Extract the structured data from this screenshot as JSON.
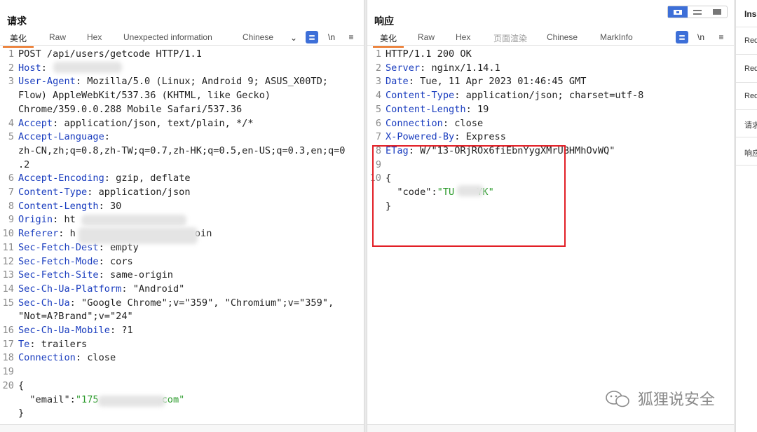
{
  "request": {
    "title": "请求",
    "tabs": [
      "美化",
      "Raw",
      "Hex",
      "Unexpected information",
      "Chinese"
    ],
    "active_tab": "美化",
    "tools": {
      "wrap": "\\n",
      "menu": "≡"
    },
    "lines": [
      {
        "n": "1",
        "key": "",
        "val": "POST /api/users/getcode HTTP/1.1"
      },
      {
        "n": "2",
        "key": "Host",
        "val": ":"
      },
      {
        "n": "3",
        "key": "User-Agent",
        "val": ": Mozilla/5.0 (Linux; Android 9; ASUS_X00TD;"
      },
      {
        "n": "",
        "key": "",
        "val": "Flow) AppleWebKit/537.36 (KHTML, like Gecko)"
      },
      {
        "n": "",
        "key": "",
        "val": "Chrome/359.0.0.288 Mobile Safari/537.36"
      },
      {
        "n": "4",
        "key": "Accept",
        "val": ": application/json, text/plain, */*"
      },
      {
        "n": "5",
        "key": "Accept-Language",
        "val": ":"
      },
      {
        "n": "",
        "key": "",
        "val": "zh-CN,zh;q=0.8,zh-TW;q=0.7,zh-HK;q=0.5,en-US;q=0.3,en;q=0"
      },
      {
        "n": "",
        "key": "",
        "val": ".2"
      },
      {
        "n": "6",
        "key": "Accept-Encoding",
        "val": ": gzip, deflate"
      },
      {
        "n": "7",
        "key": "Content-Type",
        "val": ": application/json"
      },
      {
        "n": "8",
        "key": "Content-Length",
        "val": ": 30"
      },
      {
        "n": "9",
        "key": "Origin",
        "val": ": ht"
      },
      {
        "n": "10",
        "key": "Referer",
        "val": ": h"
      },
      {
        "n": "11",
        "key": "Sec-Fetch-Dest",
        "val": ": empty"
      },
      {
        "n": "12",
        "key": "Sec-Fetch-Mode",
        "val": ": cors"
      },
      {
        "n": "13",
        "key": "Sec-Fetch-Site",
        "val": ": same-origin"
      },
      {
        "n": "14",
        "key": "Sec-Ch-Ua-Platform",
        "val": ": \"Android\""
      },
      {
        "n": "15",
        "key": "Sec-Ch-Ua",
        "val": ": \"Google Chrome\";v=\"359\", \"Chromium\";v=\"359\","
      },
      {
        "n": "",
        "key": "",
        "val": "\"Not=A?Brand\";v=\"24\""
      },
      {
        "n": "16",
        "key": "Sec-Ch-Ua-Mobile",
        "val": ": ?1"
      },
      {
        "n": "17",
        "key": "Te",
        "val": ": trailers"
      },
      {
        "n": "18",
        "key": "Connection",
        "val": ": close"
      },
      {
        "n": "19",
        "key": "",
        "val": ""
      },
      {
        "n": "20",
        "key": "",
        "val": "{"
      },
      {
        "n": "",
        "key": "",
        "val": "  \"email\":"
      },
      {
        "n": "",
        "key": "",
        "val": "}"
      }
    ],
    "referer_tail": "oin",
    "email_prefix": "\"175",
    "email_suffix": "com\""
  },
  "response": {
    "title": "响应",
    "tabs": [
      "美化",
      "Raw",
      "Hex",
      "页面渲染",
      "Chinese",
      "MarkInfo"
    ],
    "active_tab": "美化",
    "tools": {
      "wrap": "\\n",
      "menu": "≡"
    },
    "lines": [
      {
        "n": "1",
        "key": "",
        "val": "HTTP/1.1 200 OK"
      },
      {
        "n": "2",
        "key": "Server",
        "val": ": nginx/1.14.1"
      },
      {
        "n": "3",
        "key": "Date",
        "val": ": Tue, 11 Apr 2023 01:46:45 GMT"
      },
      {
        "n": "4",
        "key": "Content-Type",
        "val": ": application/json; charset=utf-8"
      },
      {
        "n": "5",
        "key": "Content-Length",
        "val": ": 19"
      },
      {
        "n": "6",
        "key": "Connection",
        "val": ": close"
      },
      {
        "n": "7",
        "key": "X-Powered-By",
        "val": ": Express"
      },
      {
        "n": "8",
        "key": "ETag",
        "val": ": W/\"13-ORjROx6fiEbnYygXMrUBHMhOvWQ\""
      },
      {
        "n": "9",
        "key": "",
        "val": ""
      },
      {
        "n": "10",
        "key": "",
        "val": "{"
      },
      {
        "n": "",
        "key": "",
        "val": "  \"code\":"
      },
      {
        "n": "",
        "key": "",
        "val": "}"
      }
    ],
    "code_prefix": "\"TU",
    "code_suffix": "YK\""
  },
  "inspector": {
    "title": "Ins",
    "items": [
      "Req",
      "Req",
      "Req",
      "请求",
      "响应"
    ]
  },
  "watermark": "狐狸说安全",
  "colors": {
    "header_key": "#1a3dbf",
    "string": "#2a9a2a",
    "accent": "#e8660f",
    "highlight": "#e21f26",
    "tool_blue": "#3d6fd8"
  }
}
